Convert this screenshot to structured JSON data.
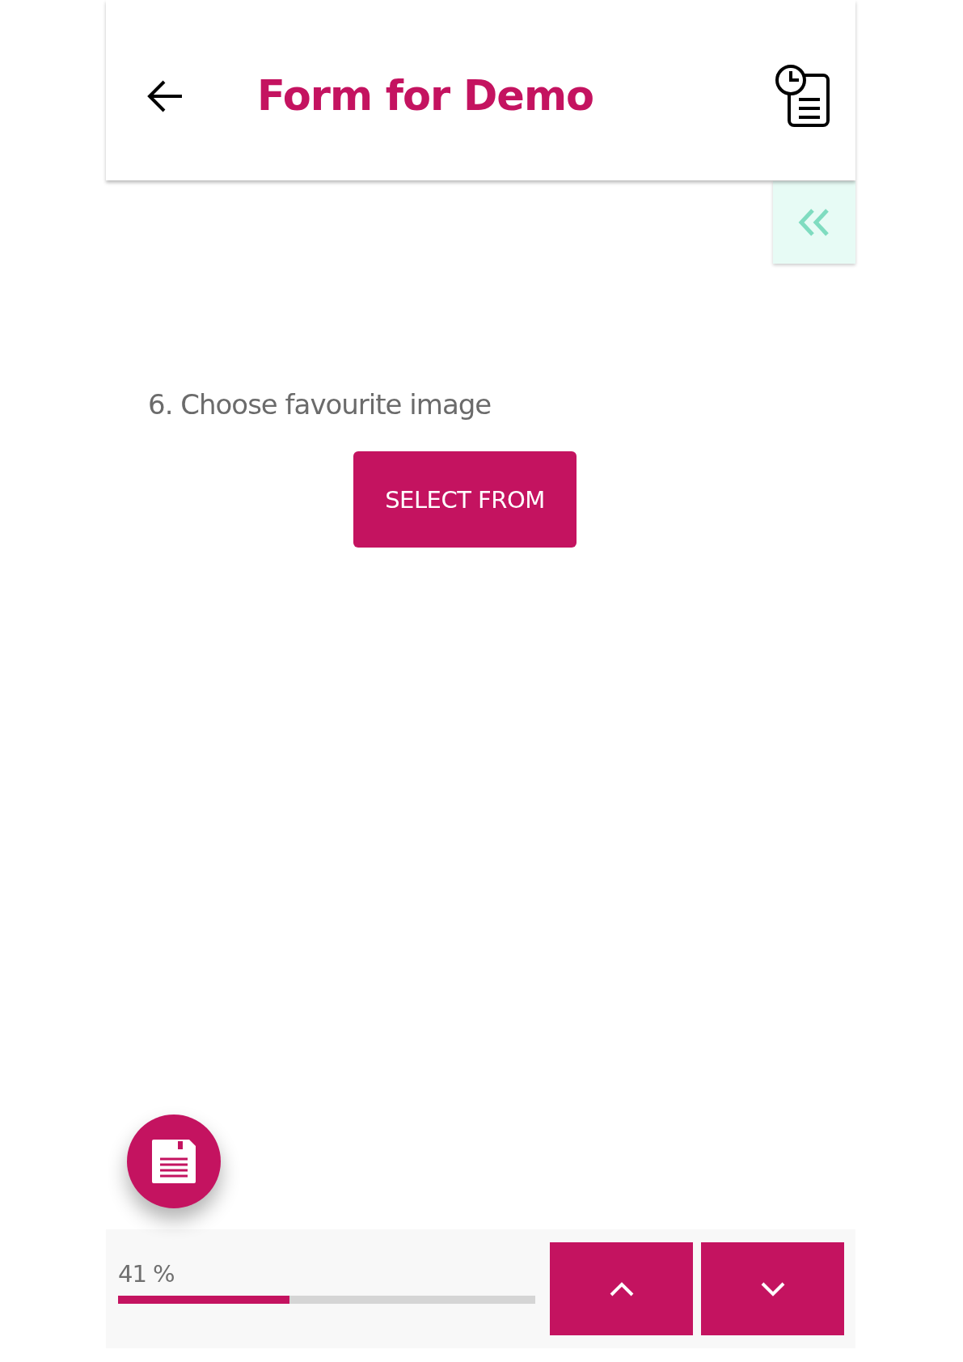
{
  "header": {
    "title": "Form for Demo"
  },
  "question": {
    "label": "6. Choose favourite image",
    "button": "SELECT FROM"
  },
  "progress": {
    "reading": "41 %",
    "level": 0.41
  }
}
